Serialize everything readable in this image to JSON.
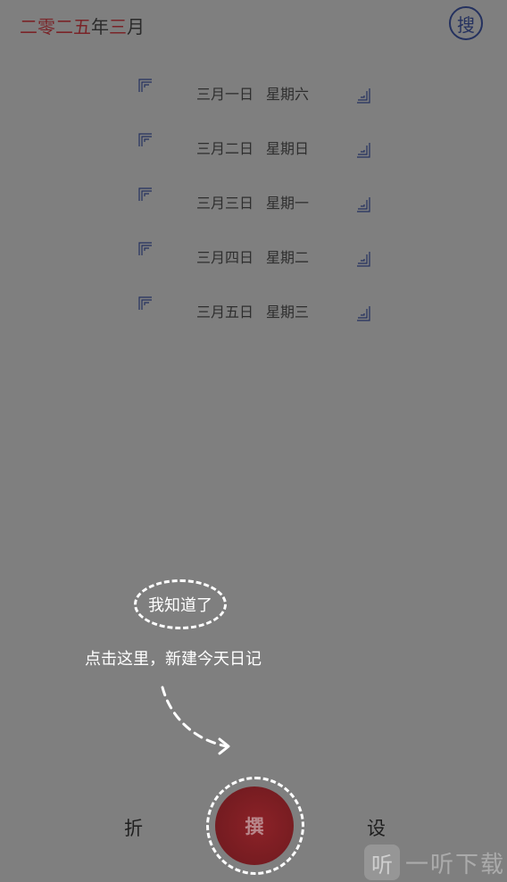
{
  "header": {
    "title_parts": [
      {
        "text": "二零二五",
        "tone": "red"
      },
      {
        "text": "年",
        "tone": "dark"
      },
      {
        "text": "三",
        "tone": "red"
      },
      {
        "text": "月",
        "tone": "dark"
      }
    ]
  },
  "search": {
    "label": "搜"
  },
  "entries": [
    {
      "date": "三月一日",
      "weekday": "星期六"
    },
    {
      "date": "三月二日",
      "weekday": "星期日"
    },
    {
      "date": "三月三日",
      "weekday": "星期一"
    },
    {
      "date": "三月四日",
      "weekday": "星期二"
    },
    {
      "date": "三月五日",
      "weekday": "星期三"
    }
  ],
  "guide": {
    "dismiss_label": "我知道了",
    "hint": "点击这里，新建今天日记"
  },
  "nav": {
    "left_label": "折",
    "compose_label": "撰",
    "right_label": "设"
  },
  "watermark": {
    "icon_char": "听",
    "text": "一听下载"
  },
  "colors": {
    "background": "#7f7f7f",
    "accent_red": "#7a2428",
    "ink_blue": "#24315f"
  }
}
